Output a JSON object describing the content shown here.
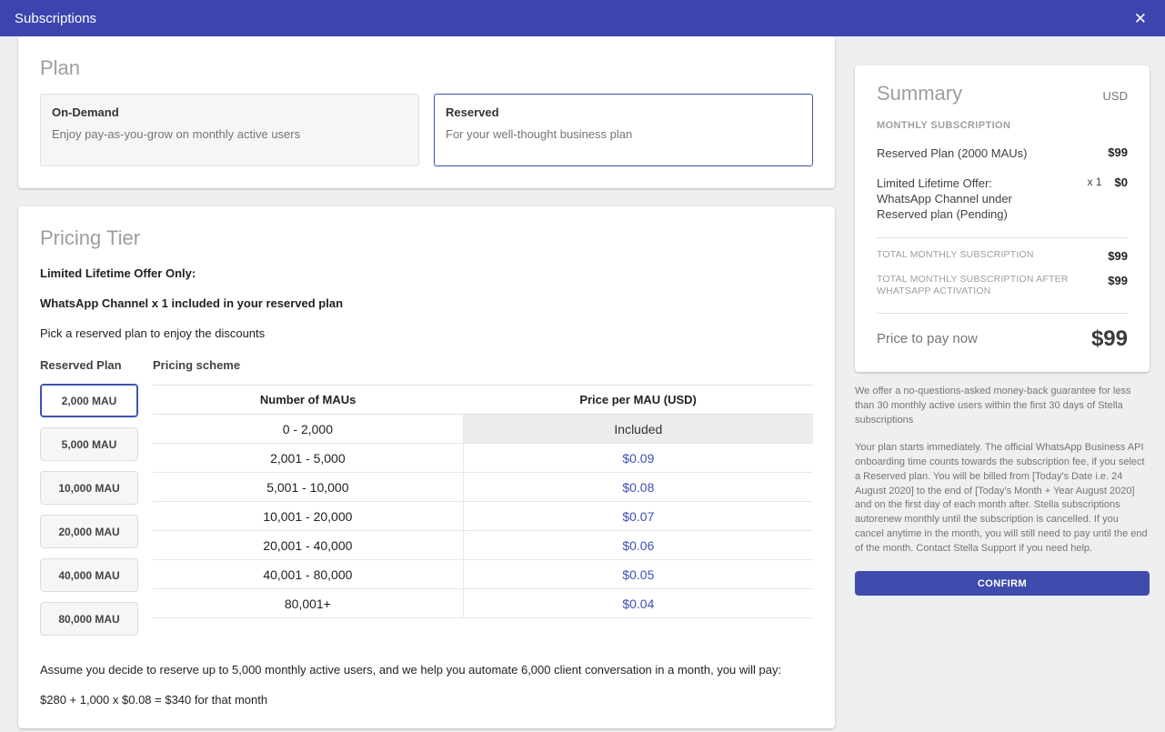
{
  "colors": {
    "header_bar": "#3c45ae",
    "accent_blue": "#3f51b5",
    "confirm_button": "#3f4cae",
    "page_background": "#eeeff1"
  },
  "header": {
    "title": "Subscriptions",
    "close_icon": "✕"
  },
  "plan": {
    "title": "Plan",
    "options": [
      {
        "name": "On-Demand",
        "description": "Enjoy pay-as-you-grow on monthly active users",
        "selected": false
      },
      {
        "name": "Reserved",
        "description": "For your well-thought business plan",
        "selected": true
      }
    ]
  },
  "pricing_tier": {
    "title": "Pricing Tier",
    "offer_line1": "Limited Lifetime Offer Only:",
    "offer_line2": "WhatsApp Channel x 1 included in your reserved plan",
    "instruction": "Pick a reserved plan to enjoy the discounts",
    "reserved_plan_label": "Reserved Plan",
    "pricing_scheme_label": "Pricing scheme",
    "plans": [
      "2,000 MAU",
      "5,000 MAU",
      "10,000 MAU",
      "20,000 MAU",
      "40,000 MAU",
      "80,000 MAU"
    ],
    "selected_plan": "2,000 MAU",
    "table": {
      "headers": [
        "Number of MAUs",
        "Price per MAU (USD)"
      ],
      "rows": [
        {
          "range": "0 - 2,000",
          "price": "Included"
        },
        {
          "range": "2,001 - 5,000",
          "price": "$0.09"
        },
        {
          "range": "5,001 - 10,000",
          "price": "$0.08"
        },
        {
          "range": "10,001 - 20,000",
          "price": "$0.07"
        },
        {
          "range": "20,001 - 40,000",
          "price": "$0.06"
        },
        {
          "range": "40,001 - 80,000",
          "price": "$0.05"
        },
        {
          "range": "80,001+",
          "price": "$0.04"
        }
      ]
    },
    "example_line1": "Assume you decide to reserve up to 5,000 monthly active users, and we help you automate 6,000 client conversation in a month, you will pay:",
    "example_line2": "$280 + 1,000 x $0.08 = $340 for that month"
  },
  "summary": {
    "title": "Summary",
    "currency": "USD",
    "section_header": "MONTHLY SUBSCRIPTION",
    "items": [
      {
        "label": "Reserved Plan (2000 MAUs)",
        "qty": "",
        "amount": "$99"
      },
      {
        "label": "Limited Lifetime Offer: WhatsApp Channel under Reserved plan (Pending)",
        "qty": "x 1",
        "amount": "$0"
      }
    ],
    "totals": [
      {
        "label": "TOTAL MONTHLY SUBSCRIPTION",
        "amount": "$99"
      },
      {
        "label": "TOTAL MONTHLY SUBSCRIPTION AFTER WHATSAPP ACTIVATION",
        "amount": "$99"
      }
    ],
    "price_to_pay": {
      "label": "Price to pay now",
      "amount": "$99"
    },
    "guarantee_text": "We offer a no-questions-asked money-back guarantee for less than 30 monthly active users within the first 30 days of Stella subscriptions",
    "terms_text": "Your plan starts immediately. The official WhatsApp Business API onboarding time counts towards the subscription fee, if you select a Reserved plan. You will be billed from [Today's Date i.e. 24 August 2020] to the end of [Today's Month + Year August 2020] and on the first day of each month after. Stella subscriptions autorenew monthly until the subscription is cancelled. If you cancel anytime in the month, you will still need to pay until the end of the month. Contact Stella Support if you need help.",
    "confirm_label": "CONFIRM"
  }
}
